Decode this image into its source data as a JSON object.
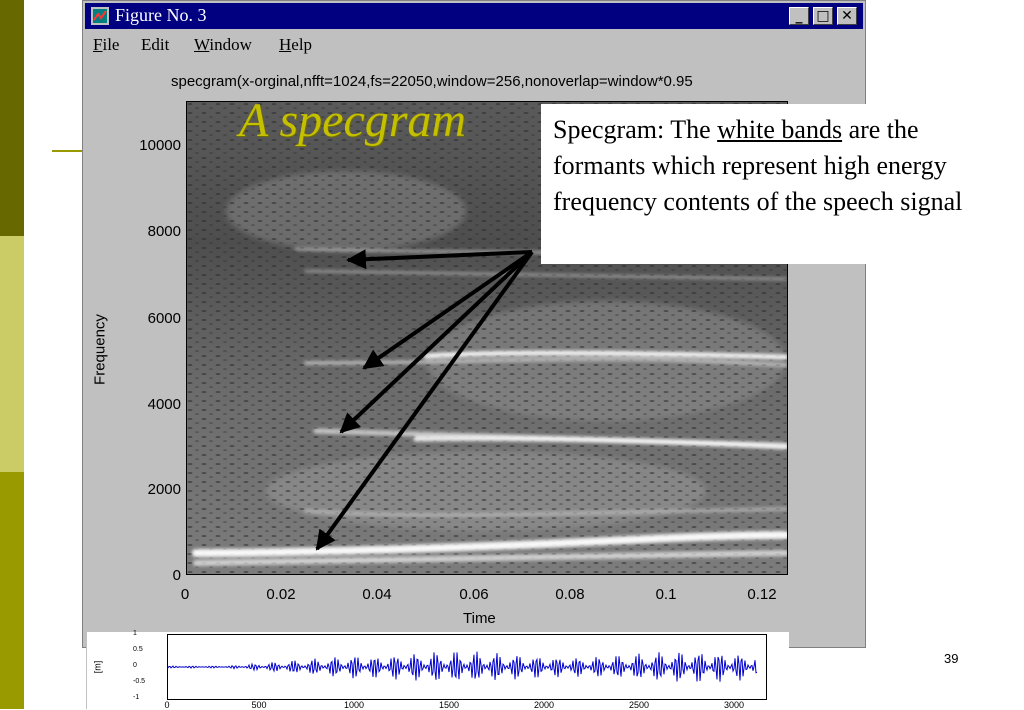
{
  "window": {
    "title": "Figure No. 3",
    "menu": [
      {
        "accel": "F",
        "rest": "ile"
      },
      {
        "accel": "",
        "rest": "Edit"
      },
      {
        "accel": "W",
        "rest": "indow"
      },
      {
        "accel": "H",
        "rest": "elp"
      }
    ],
    "minimize_glyph": "_",
    "maximize_glyph": "□",
    "close_glyph": "✕"
  },
  "plot": {
    "title": "specgram(x-orginal,nfft=1024,fs=22050,window=256,nonoverlap=window*0.95",
    "overlay_title": "A specgram",
    "xlabel": "Time",
    "ylabel": "Frequency",
    "xticks": [
      "0",
      "0.02",
      "0.04",
      "0.06",
      "0.08",
      "0.1",
      "0.12"
    ],
    "yticks": [
      "0",
      "2000",
      "4000",
      "6000",
      "8000",
      "10000"
    ]
  },
  "callout": {
    "prefix": "Specgram: The ",
    "underlined": "white bands",
    "suffix": " are the formants which represent high energy frequency contents of the speech signal"
  },
  "waveform": {
    "ylabel": "[m]",
    "yticks": [
      "1",
      "0.5",
      "0",
      "-0.5",
      "-1"
    ],
    "xticks": [
      "0",
      "500",
      "1000",
      "1500",
      "2000",
      "2500",
      "3000"
    ]
  },
  "slide_number": "39",
  "colors": {
    "title_bar": "#000080",
    "overlay_title": "#c4c000",
    "waveform": "#0000cc",
    "sidebar_dark": "#686800",
    "sidebar_mid": "#cccc66",
    "sidebar_low": "#999900"
  }
}
